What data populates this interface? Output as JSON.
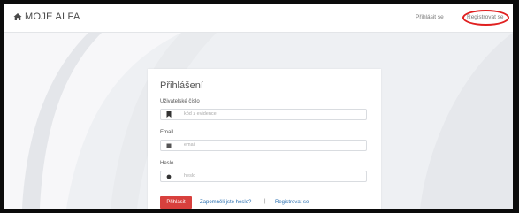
{
  "header": {
    "brand": "MOJE ALFA",
    "nav_login": "Přihlásit se",
    "nav_register": "Registrovat se"
  },
  "form": {
    "title": "Přihlášení",
    "username_label": "Uživatelské číslo",
    "username_placeholder": "kód z evidence",
    "email_label": "Email",
    "email_placeholder": "email",
    "password_label": "Heslo",
    "password_placeholder": "heslo",
    "submit_label": "Přihlásit",
    "forgot_link": "Zapomněli jste heslo?",
    "separator": "|",
    "register_link": "Registrovat se"
  },
  "colors": {
    "accent": "#d8403d",
    "link": "#2a6fb0",
    "highlight": "#e02020"
  }
}
